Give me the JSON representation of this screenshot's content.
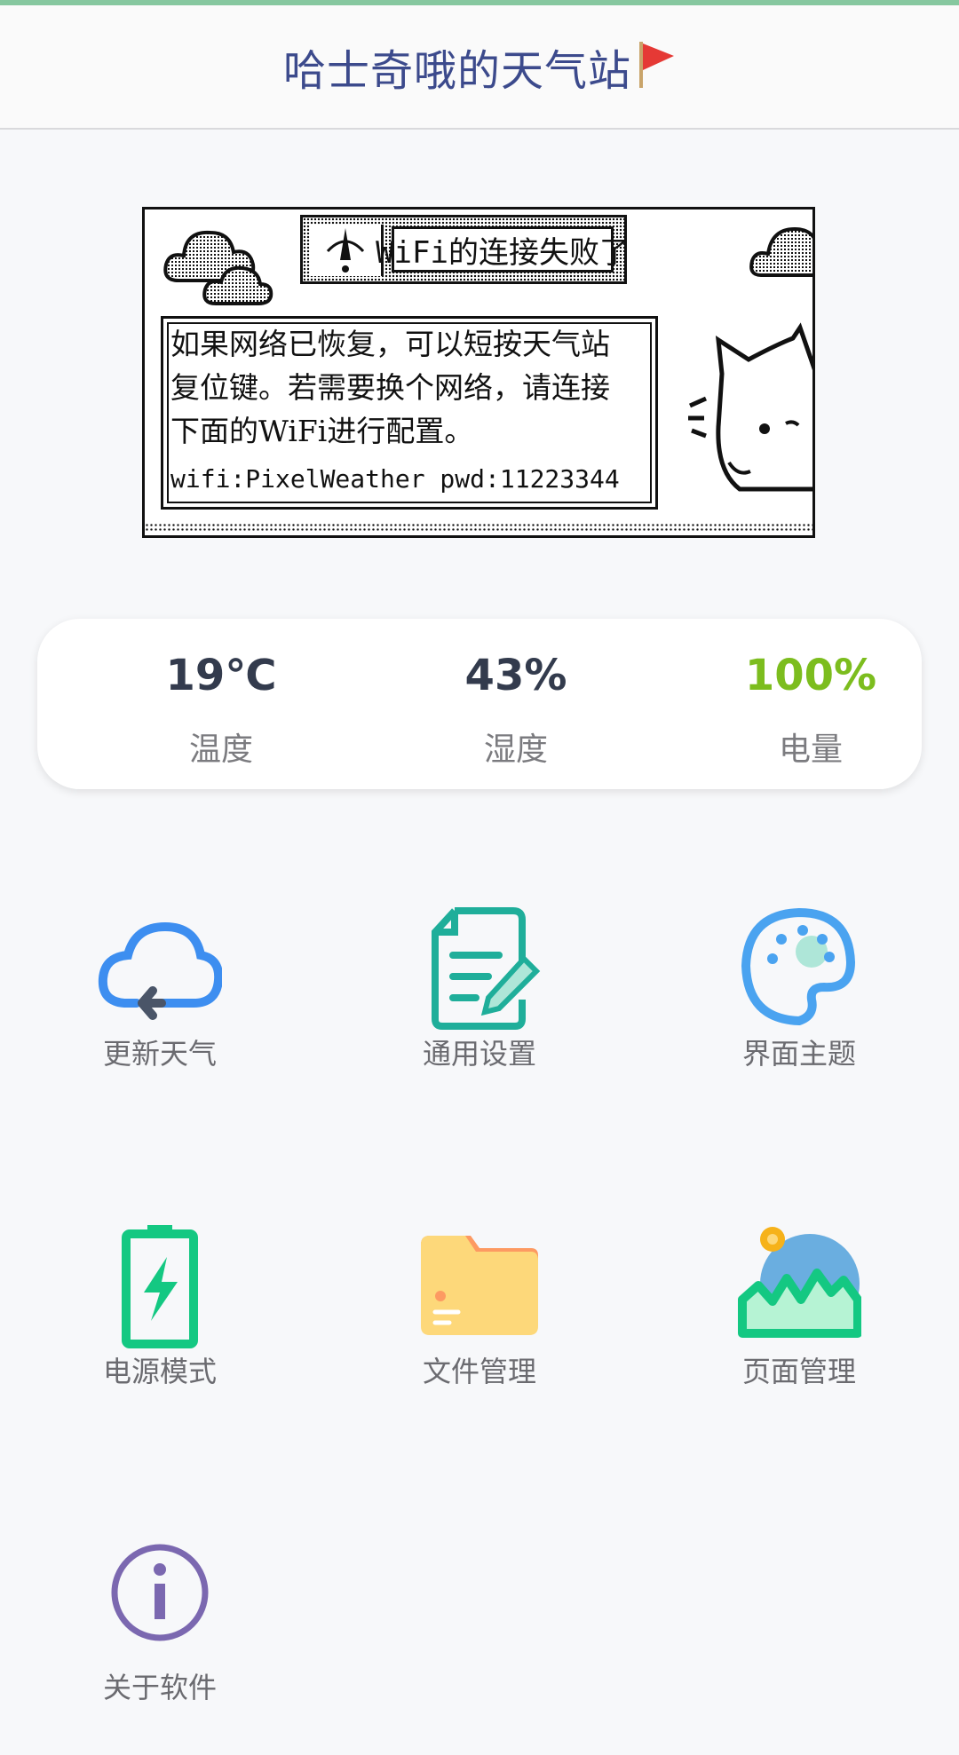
{
  "header": {
    "title": "哈士奇哦的天气站",
    "flag_icon": "red-flag-icon"
  },
  "preview": {
    "title": "WiFi的连接失败了",
    "lines": [
      "如果网络已恢复，可以短按天气站",
      "复位键。若需要换个网络，请连接",
      "下面的WiFi进行配置。"
    ],
    "wifi": "wifi:PixelWeather  pwd:11223344"
  },
  "stats": [
    {
      "value": "19℃",
      "label": "温度",
      "color": "#333b4d"
    },
    {
      "value": "43%",
      "label": "湿度",
      "color": "#333b4d"
    },
    {
      "value": "100%",
      "label": "电量",
      "color": "#7cbd1e"
    }
  ],
  "menu": [
    {
      "label": "更新天气",
      "icon": "cloud-refresh-icon"
    },
    {
      "label": "通用设置",
      "icon": "document-edit-icon"
    },
    {
      "label": "界面主题",
      "icon": "palette-icon"
    },
    {
      "label": "电源模式",
      "icon": "battery-charging-icon"
    },
    {
      "label": "文件管理",
      "icon": "folder-icon"
    },
    {
      "label": "页面管理",
      "icon": "landscape-image-icon"
    },
    {
      "label": "关于软件",
      "icon": "info-icon"
    }
  ],
  "colors": {
    "title": "#3c4a8c",
    "accent_green": "#7cbd1e",
    "topstripe": "#86c79f"
  }
}
